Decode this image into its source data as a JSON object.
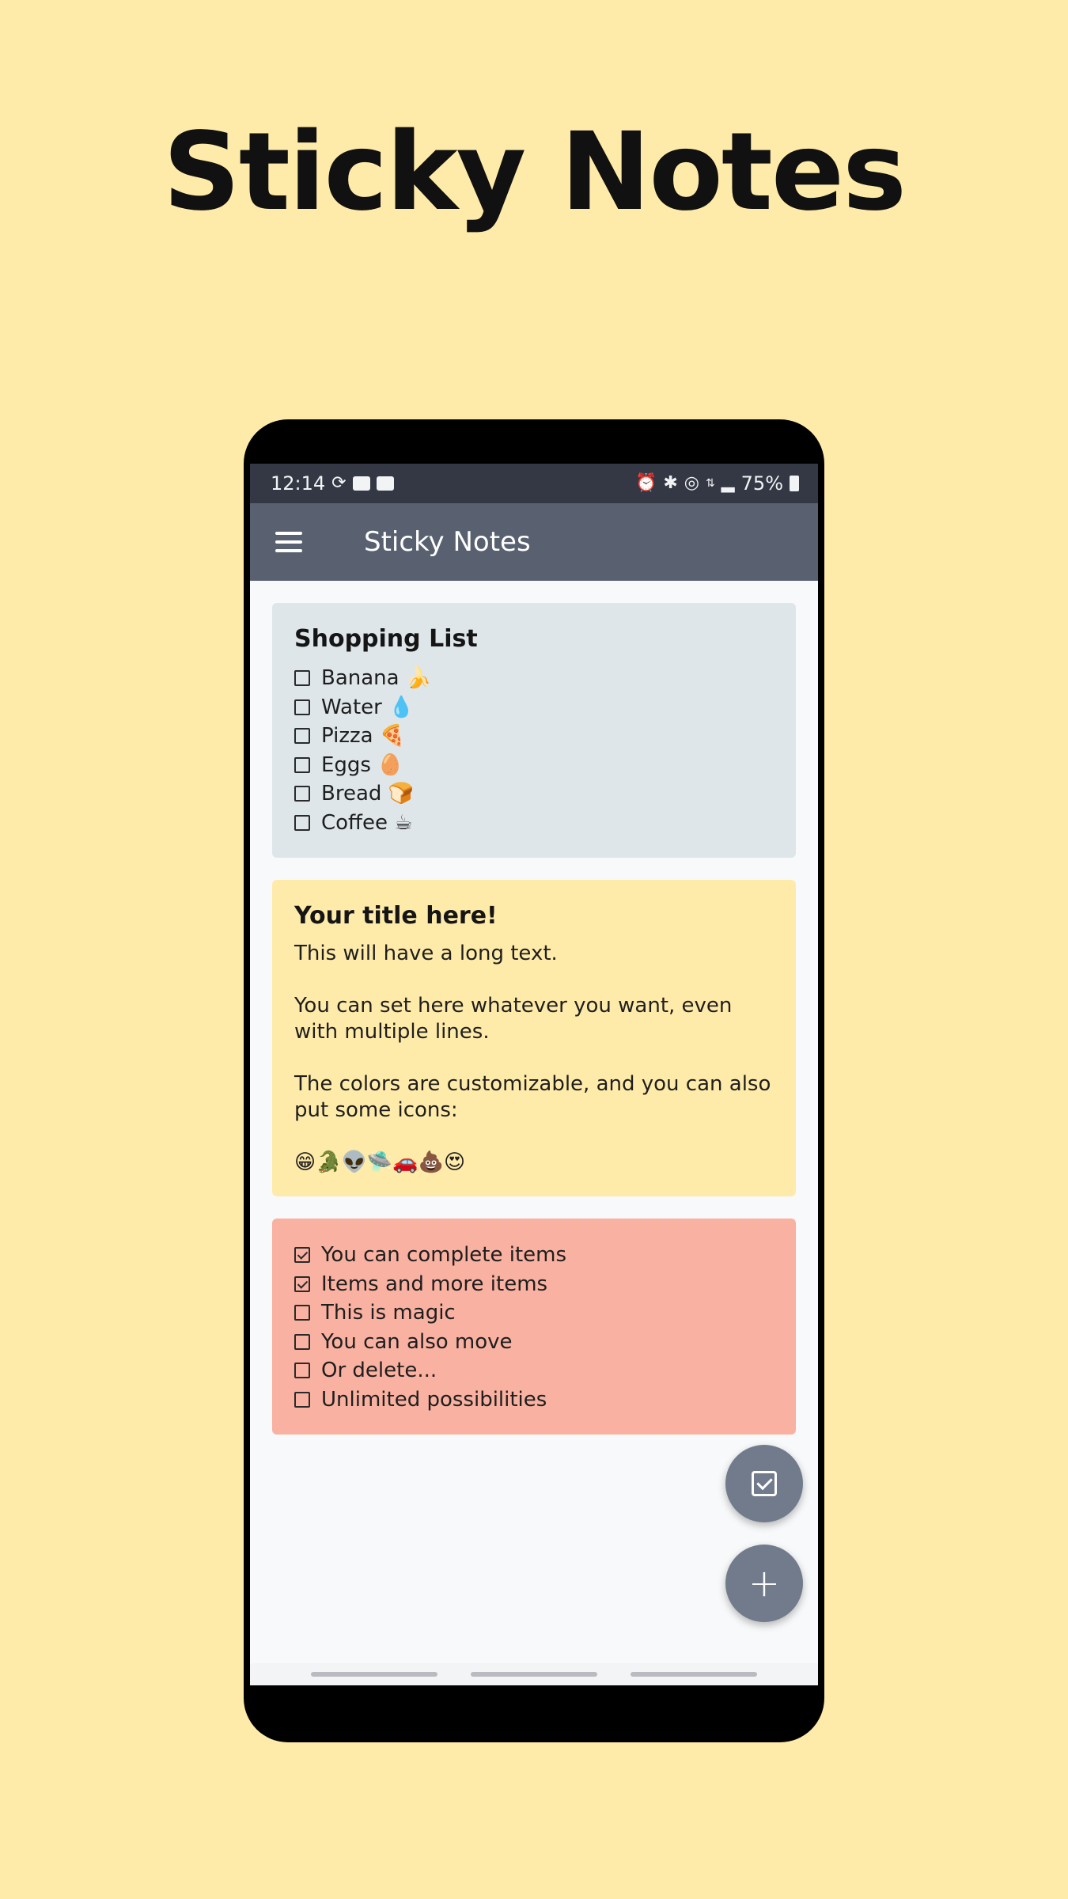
{
  "promo": {
    "title": "Sticky Notes"
  },
  "status_bar": {
    "time": "12:14",
    "battery": "75%",
    "left_icons": [
      "sync-icon",
      "image-icon",
      "mail-icon"
    ],
    "right_icons": [
      "alarm-icon",
      "bluetooth-icon",
      "hotspot-icon",
      "network-4g-icon",
      "signal-icon",
      "battery-icon"
    ]
  },
  "app_bar": {
    "title": "Sticky Notes",
    "menu_icon": "menu-icon"
  },
  "notes": [
    {
      "title": "Shopping List",
      "color": "#DEE6E9",
      "items": [
        {
          "label": "Banana 🍌",
          "checked": false
        },
        {
          "label": "Water 💧",
          "checked": false
        },
        {
          "label": "Pizza 🍕",
          "checked": false
        },
        {
          "label": "Eggs 🥚",
          "checked": false
        },
        {
          "label": "Bread 🍞",
          "checked": false
        },
        {
          "label": "Coffee ☕",
          "checked": false
        }
      ]
    },
    {
      "title": "Your title here!",
      "color": "#FFEBA9",
      "paragraphs": [
        "This will have a long text.",
        "You can set here whatever you want, even with multiple lines.",
        "The colors are customizable, and you can also put some icons:",
        "😁🐊👽🛸🚗💩😍"
      ]
    },
    {
      "title": "",
      "color": "#F9B1A1",
      "items": [
        {
          "label": "You can complete items",
          "checked": true
        },
        {
          "label": "Items and more items",
          "checked": true
        },
        {
          "label": "This is magic",
          "checked": false
        },
        {
          "label": "You can also move",
          "checked": false
        },
        {
          "label": "Or delete...",
          "checked": false
        },
        {
          "label": "Unlimited possibilities",
          "checked": false
        }
      ]
    }
  ],
  "fabs": {
    "check_icon": "check-square-icon",
    "add_icon": "plus-icon",
    "add_glyph": "+"
  },
  "colors": {
    "background": "#FFEBA9",
    "status_bar": "#333844",
    "app_bar": "#596170",
    "fab": "#717B8C"
  }
}
